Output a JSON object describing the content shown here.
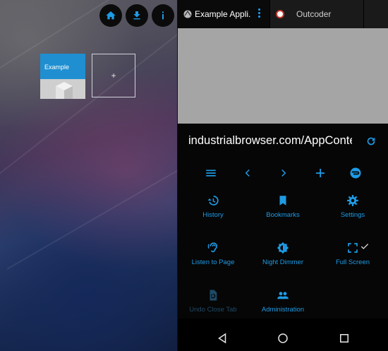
{
  "launcher": {
    "buttons": [
      {
        "name": "home-button",
        "icon": "home-icon"
      },
      {
        "name": "download-button",
        "icon": "download-icon"
      },
      {
        "name": "info-button",
        "icon": "info-icon"
      }
    ],
    "tile_label": "Example",
    "add_tile_label": "+"
  },
  "browser": {
    "tabs": [
      {
        "label": "Example Appli..."
      },
      {
        "label": "Outcoder"
      }
    ],
    "url": "industrialbrowser.com/AppConter",
    "menu_items": [
      {
        "label": "History",
        "icon": "history-icon"
      },
      {
        "label": "Bookmarks",
        "icon": "bookmark-icon"
      },
      {
        "label": "Settings",
        "icon": "gear-icon"
      },
      {
        "label": "Listen to Page",
        "icon": "ear-icon"
      },
      {
        "label": "Night Dimmer",
        "icon": "brightness-icon"
      },
      {
        "label": "Full Screen",
        "icon": "fullscreen-icon",
        "checked": true
      },
      {
        "label": "Undo Close Tab",
        "icon": "undo-tab-icon",
        "disabled": true
      },
      {
        "label": "Administration",
        "icon": "people-icon"
      }
    ],
    "colors": {
      "accent": "#1e9be5",
      "content_bg": "#a5a5a5",
      "menu_bg": "#060606"
    }
  }
}
